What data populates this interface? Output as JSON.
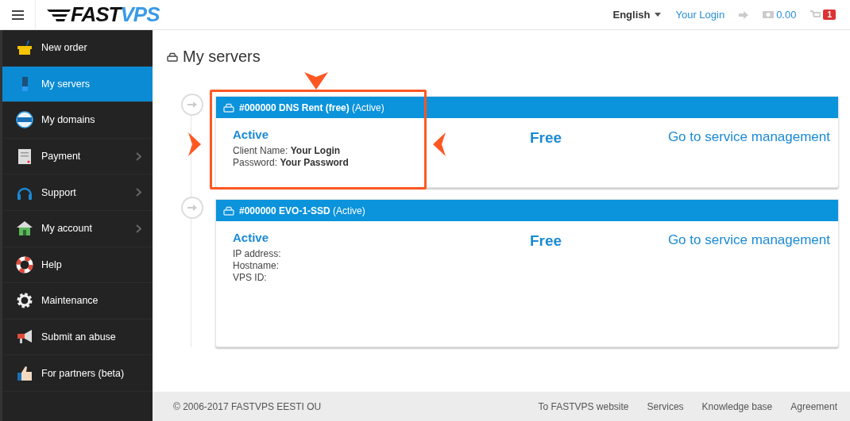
{
  "header": {
    "logo": {
      "dark": "FAST",
      "light": "VPS"
    },
    "language": "English",
    "login": "Your Login",
    "balance": "0.00",
    "cart_count": "1"
  },
  "sidebar": {
    "items": [
      {
        "label": "New order",
        "selected": false,
        "submenu": false
      },
      {
        "label": "My servers",
        "selected": true,
        "submenu": false
      },
      {
        "label": "My domains",
        "selected": false,
        "submenu": false
      },
      {
        "label": "Payment",
        "selected": false,
        "submenu": true
      },
      {
        "label": "Support",
        "selected": false,
        "submenu": true
      },
      {
        "label": "My account",
        "selected": false,
        "submenu": true
      },
      {
        "label": "Help",
        "selected": false,
        "submenu": false
      },
      {
        "label": "Maintenance",
        "selected": false,
        "submenu": false
      },
      {
        "label": "Submit an abuse",
        "selected": false,
        "submenu": false
      },
      {
        "label": "For partners (beta)",
        "selected": false,
        "submenu": false
      }
    ]
  },
  "page_title": "My servers",
  "servers": [
    {
      "title": "#000000 DNS Rent (free)",
      "status": "(Active)",
      "state": "Active",
      "details": [
        {
          "label": "Client Name:",
          "value": "Your Login"
        },
        {
          "label": "Password:",
          "value": "Your Password"
        }
      ],
      "price": "Free",
      "link": "Go to service management",
      "highlighted": true
    },
    {
      "title": "#000000 EVO-1-SSD",
      "status": "(Active)",
      "state": "Active",
      "details": [
        {
          "label": "IP address:"
        },
        {
          "label": "Hostname:"
        },
        {
          "label": "VPS ID:"
        }
      ],
      "price": "Free",
      "link": "Go to service management",
      "highlighted": false
    }
  ],
  "footer": {
    "copyright": "© 2006-2017 FASTVPS EESTI OU",
    "links": [
      "To FASTVPS website",
      "Services",
      "Knowledge base",
      "Agreement"
    ]
  }
}
